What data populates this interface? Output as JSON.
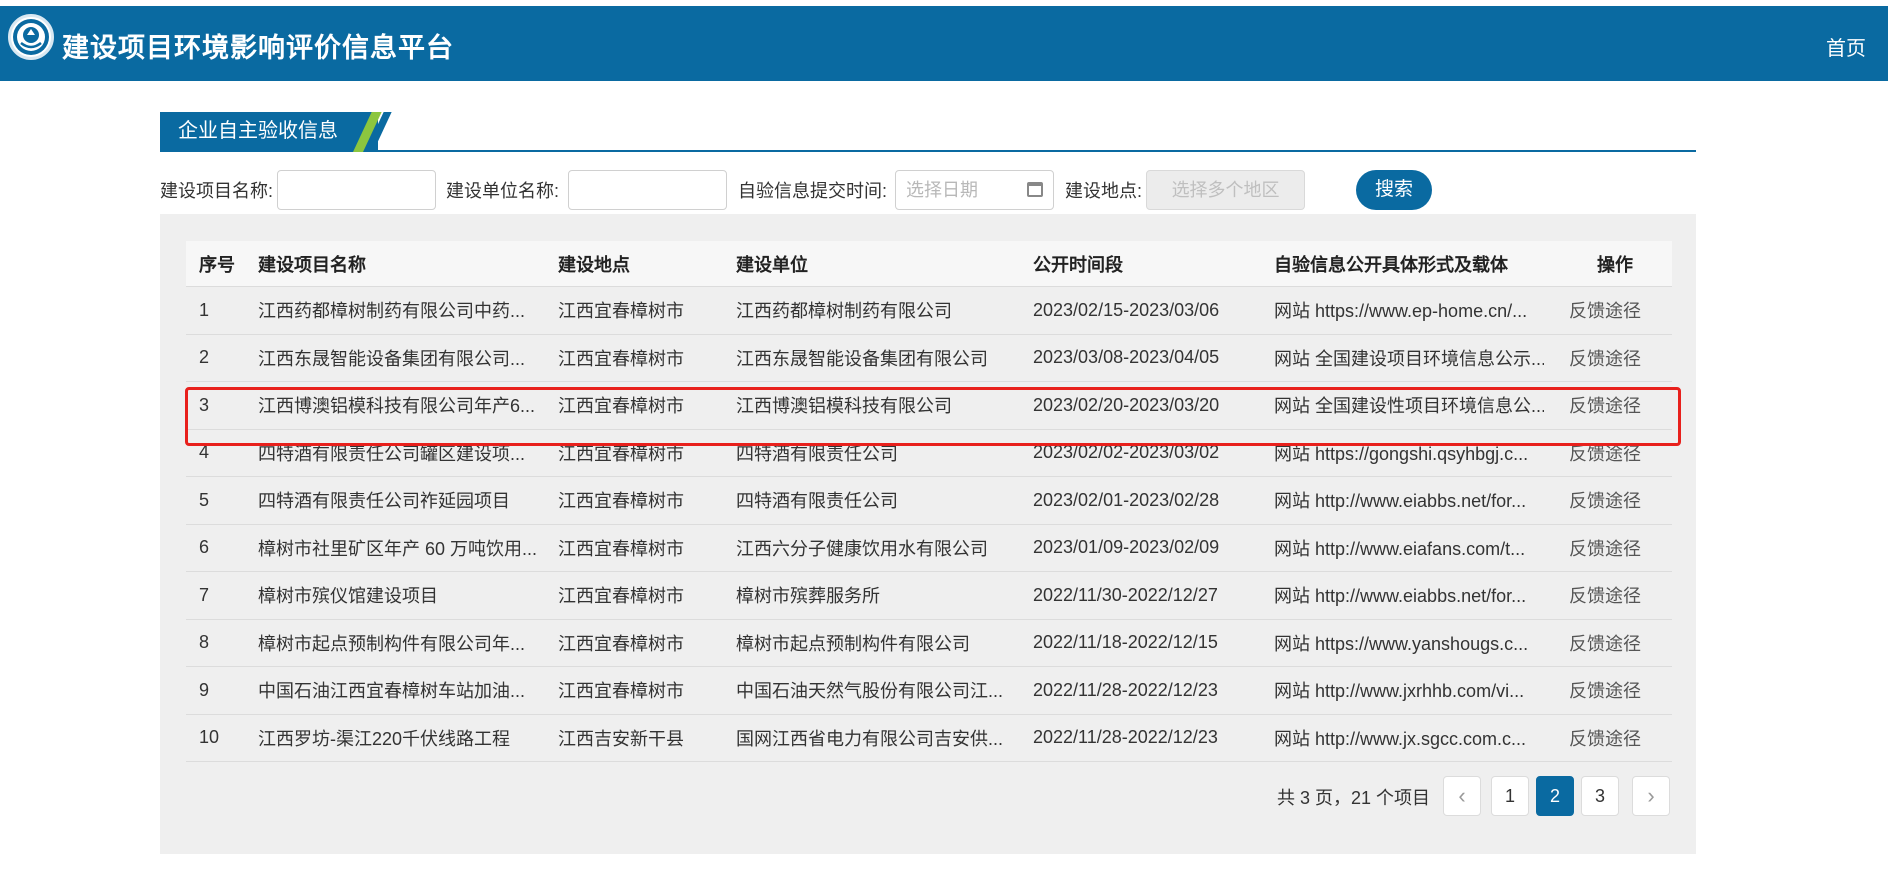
{
  "header": {
    "site_title": "建设项目环境影响评价信息平台",
    "home_label": "首页",
    "logo_icon": "emblem-logo-icon"
  },
  "section": {
    "title": "企业自主验收信息"
  },
  "filters": {
    "project_name_label": "建设项目名称:",
    "project_name_value": "",
    "unit_name_label": "建设单位名称:",
    "unit_name_value": "",
    "submit_time_label": "自验信息提交时间:",
    "submit_time_placeholder": "选择日期",
    "location_label": "建设地点:",
    "location_placeholder": "选择多个地区",
    "search_label": "搜索"
  },
  "table": {
    "columns": [
      "序号",
      "建设项目名称",
      "建设地点",
      "建设单位",
      "公开时间段",
      "自验信息公开具体形式及载体",
      "操作"
    ],
    "rows": [
      [
        "1",
        "江西药都樟树制药有限公司中药...",
        "江西宜春樟树市",
        "江西药都樟树制药有限公司",
        "2023/02/15-2023/03/06",
        "网站 https://www.ep-home.cn/...",
        "反馈途径"
      ],
      [
        "2",
        "江西东晟智能设备集团有限公司...",
        "江西宜春樟树市",
        "江西东晟智能设备集团有限公司",
        "2023/03/08-2023/04/05",
        "网站 全国建设项目环境信息公示...",
        "反馈途径"
      ],
      [
        "3",
        "江西博澳铝模科技有限公司年产6...",
        "江西宜春樟树市",
        "江西博澳铝模科技有限公司",
        "2023/02/20-2023/03/20",
        "网站 全国建设性项目环境信息公...",
        "反馈途径"
      ],
      [
        "4",
        "四特酒有限责任公司罐区建设项...",
        "江西宜春樟树市",
        "四特酒有限责任公司",
        "2023/02/02-2023/03/02",
        "网站 https://gongshi.qsyhbgj.c...",
        "反馈途径"
      ],
      [
        "5",
        "四特酒有限责任公司祚延园项目",
        "江西宜春樟树市",
        "四特酒有限责任公司",
        "2023/02/01-2023/02/28",
        "网站 http://www.eiabbs.net/for...",
        "反馈途径"
      ],
      [
        "6",
        "樟树市社里矿区年产 60 万吨饮用...",
        "江西宜春樟树市",
        "江西六分子健康饮用水有限公司",
        "2023/01/09-2023/02/09",
        "网站 http://www.eiafans.com/t...",
        "反馈途径"
      ],
      [
        "7",
        "樟树市殡仪馆建设项目",
        "江西宜春樟树市",
        "樟树市殡葬服务所",
        "2022/11/30-2022/12/27",
        "网站 http://www.eiabbs.net/for...",
        "反馈途径"
      ],
      [
        "8",
        "樟树市起点预制构件有限公司年...",
        "江西宜春樟树市",
        "樟树市起点预制构件有限公司",
        "2022/11/18-2022/12/15",
        "网站 https://www.yanshougs.c...",
        "反馈途径"
      ],
      [
        "9",
        "中国石油江西宜春樟树车站加油...",
        "江西宜春樟树市",
        "中国石油天然气股份有限公司江...",
        "2022/11/28-2022/12/23",
        "网站 http://www.jxrhhb.com/vi...",
        "反馈途径"
      ],
      [
        "10",
        "江西罗坊-渠江220千伏线路工程",
        "江西吉安新干县",
        "国网江西省电力有限公司吉安供...",
        "2022/11/28-2022/12/23",
        "网站 http://www.jx.sgcc.com.c...",
        "反馈途径"
      ]
    ]
  },
  "pagination": {
    "total_text": "共 3 页，21 个项目",
    "prev_icon": "chevron-left-icon",
    "next_icon": "chevron-right-icon",
    "prev_glyph": "‹",
    "next_glyph": "›",
    "pages": [
      "1",
      "2",
      "3"
    ],
    "current_page": "2"
  },
  "colors": {
    "brand_blue": "#0a6aa1",
    "accent_green": "#8cc63f",
    "highlight_red": "#e8201c"
  }
}
